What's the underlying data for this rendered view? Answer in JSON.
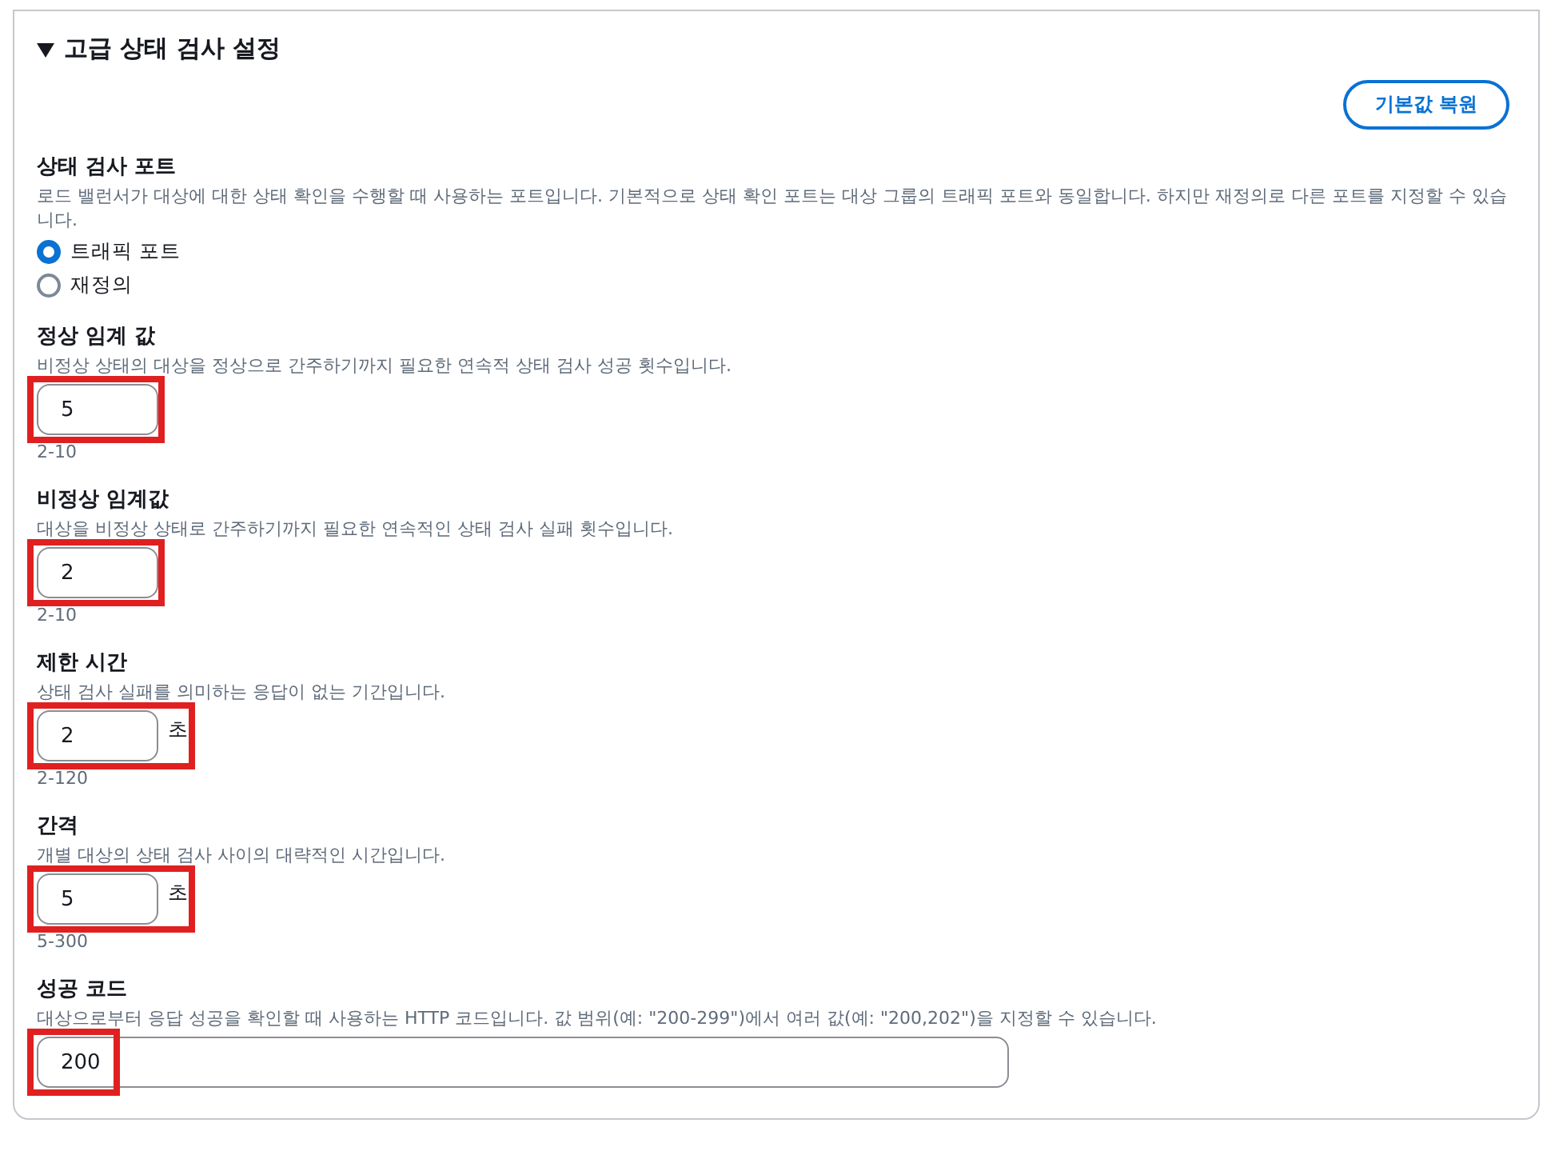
{
  "section": {
    "title": "고급 상태 검사 설정",
    "expanded": true
  },
  "reset_button": "기본값 복원",
  "port": {
    "label": "상태 검사 포트",
    "description": "로드 밸런서가 대상에 대한 상태 확인을 수행할 때 사용하는 포트입니다. 기본적으로 상태 확인 포트는 대상 그룹의 트래픽 포트와 동일합니다. 하지만 재정의로 다른 포트를 지정할 수 있습니다.",
    "options": [
      {
        "label": "트래픽 포트",
        "selected": true
      },
      {
        "label": "재정의",
        "selected": false
      }
    ]
  },
  "fields": [
    {
      "kind": "number",
      "label": "정상 임계 값",
      "description": "비정상 상태의 대상을 정상으로 간주하기까지 필요한 연속적 상태 검사 성공 횟수입니다.",
      "value": "5",
      "range": "2-10",
      "highlighted": true
    },
    {
      "kind": "number",
      "label": "비정상 임계값",
      "description": "대상을 비정상 상태로 간주하기까지 필요한 연속적인 상태 검사 실패 횟수입니다.",
      "value": "2",
      "range": "2-10",
      "highlighted": true
    },
    {
      "kind": "number",
      "label": "제한 시간",
      "description": "상태 검사 실패를 의미하는 응답이 없는 기간입니다.",
      "value": "2",
      "unit": "초",
      "range": "2-120",
      "highlighted": true
    },
    {
      "kind": "number",
      "label": "간격",
      "description": "개별 대상의 상태 검사 사이의 대략적인 시간입니다.",
      "value": "5",
      "unit": "초",
      "range": "5-300",
      "highlighted": true
    },
    {
      "kind": "text",
      "label": "성공 코드",
      "description": "대상으로부터 응답 성공을 확인할 때 사용하는 HTTP 코드입니다. 값 범위(예: \"200-299\")에서 여러 값(예: \"200,202\")을 지정할 수 있습니다.",
      "value": "200",
      "highlighted": true
    }
  ]
}
